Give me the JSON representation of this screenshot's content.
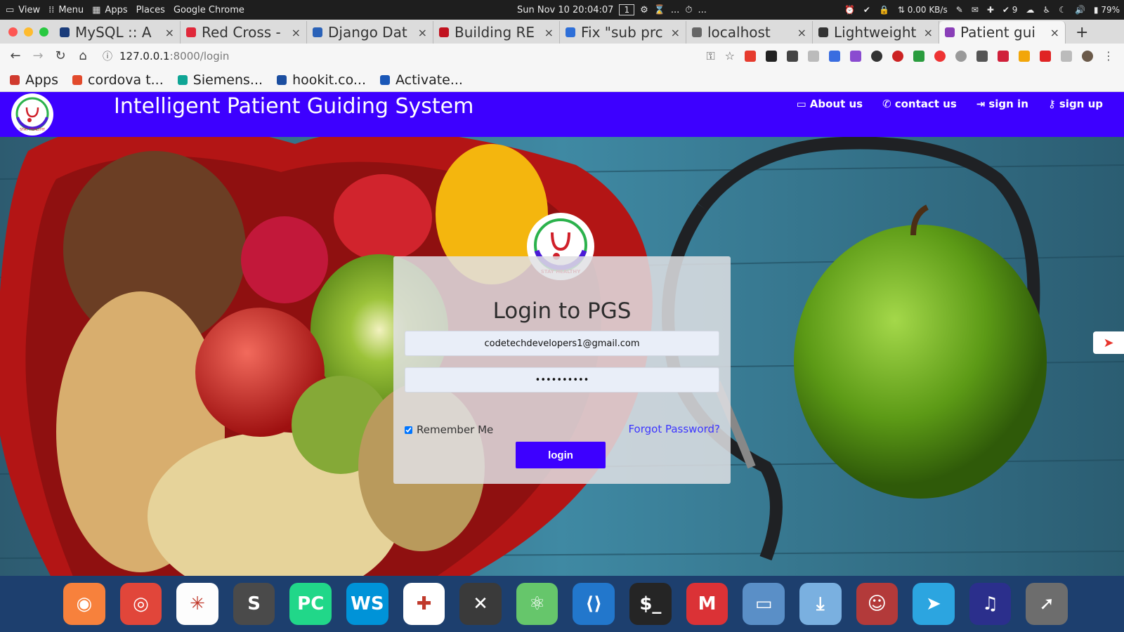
{
  "os_bar": {
    "view": "View",
    "menu": "Menu",
    "apps": "Apps",
    "places": "Places",
    "app_name": "Google Chrome",
    "datetime": "Sun Nov 10  20:04:07",
    "workspace": "1",
    "ellipsis_1": "...",
    "ellipsis_2": "...",
    "netspeed": "0.00 KB/s",
    "notif_count": "9",
    "battery": "79%"
  },
  "tabs": [
    {
      "title": "MySQL :: A",
      "color": "#1a3c7a"
    },
    {
      "title": "Red Cross -",
      "color": "#e0283a"
    },
    {
      "title": "Django Dat",
      "color": "#2a62b8"
    },
    {
      "title": "Building RE",
      "color": "#c1121f"
    },
    {
      "title": "Fix \"sub prc",
      "color": "#2e6fd8"
    },
    {
      "title": "localhost",
      "color": "#666666"
    },
    {
      "title": "Lightweight",
      "color": "#333333"
    },
    {
      "title": "Patient gui",
      "color": "#8a3fb8"
    }
  ],
  "address": {
    "host": "127.0.0.1",
    "path": ":8000/login"
  },
  "bookmarks": [
    {
      "label": "Apps",
      "color": "#d03a2e"
    },
    {
      "label": "cordova t...",
      "color": "#e24a2c"
    },
    {
      "label": "Siemens...",
      "color": "#0fa595"
    },
    {
      "label": "hookit.co...",
      "color": "#1b4ea0"
    },
    {
      "label": "Activate...",
      "color": "#1a57b7"
    }
  ],
  "site": {
    "title": "Intelligent Patient Guiding System",
    "brand_color": "#3d00ff",
    "nav": [
      {
        "label": "About us",
        "icon": "laptop-icon"
      },
      {
        "label": "contact us",
        "icon": "phone-icon"
      },
      {
        "label": "sign in",
        "icon": "sign-in-icon"
      },
      {
        "label": "sign up",
        "icon": "key-icon"
      }
    ],
    "logo_text": "STAY HEALTHY"
  },
  "login": {
    "title": "Login to PGS",
    "email_value": "codetechdevelopers1@gmail.com",
    "password_value": "••••••••••",
    "remember_label": "Remember Me",
    "remember_checked": true,
    "forgot_label": "Forgot Password?",
    "button_label": "login"
  },
  "dock": [
    {
      "name": "firefox",
      "color": "#f7813c",
      "glyph": "◉"
    },
    {
      "name": "chrome",
      "color": "#e1463a",
      "glyph": "◎"
    },
    {
      "name": "network",
      "color": "#fdfdfd",
      "glyph": "✳"
    },
    {
      "name": "sublime",
      "color": "#4a4a4a",
      "glyph": "S"
    },
    {
      "name": "pycharm",
      "color": "#21d789",
      "glyph": "PC"
    },
    {
      "name": "webstorm",
      "color": "#0093d8",
      "glyph": "WS"
    },
    {
      "name": "slack",
      "color": "#ffffff",
      "glyph": "✚"
    },
    {
      "name": "xampp",
      "color": "#3a3a3a",
      "glyph": "✕"
    },
    {
      "name": "atom",
      "color": "#66c66b",
      "glyph": "⚛"
    },
    {
      "name": "vscode",
      "color": "#2277cc",
      "glyph": "⟨⟩"
    },
    {
      "name": "terminal",
      "color": "#252525",
      "glyph": "$_"
    },
    {
      "name": "gmail",
      "color": "#db3236",
      "glyph": "M"
    },
    {
      "name": "files",
      "color": "#5a8fc7",
      "glyph": "▭"
    },
    {
      "name": "software-center",
      "color": "#7ab0e0",
      "glyph": "⤓"
    },
    {
      "name": "teams",
      "color": "#b33a3a",
      "glyph": "☺"
    },
    {
      "name": "telegram",
      "color": "#2ca5e0",
      "glyph": "➤"
    },
    {
      "name": "music",
      "color": "#2b2f8c",
      "glyph": "♫"
    },
    {
      "name": "launcher",
      "color": "#6d6d6d",
      "glyph": "➚"
    }
  ]
}
